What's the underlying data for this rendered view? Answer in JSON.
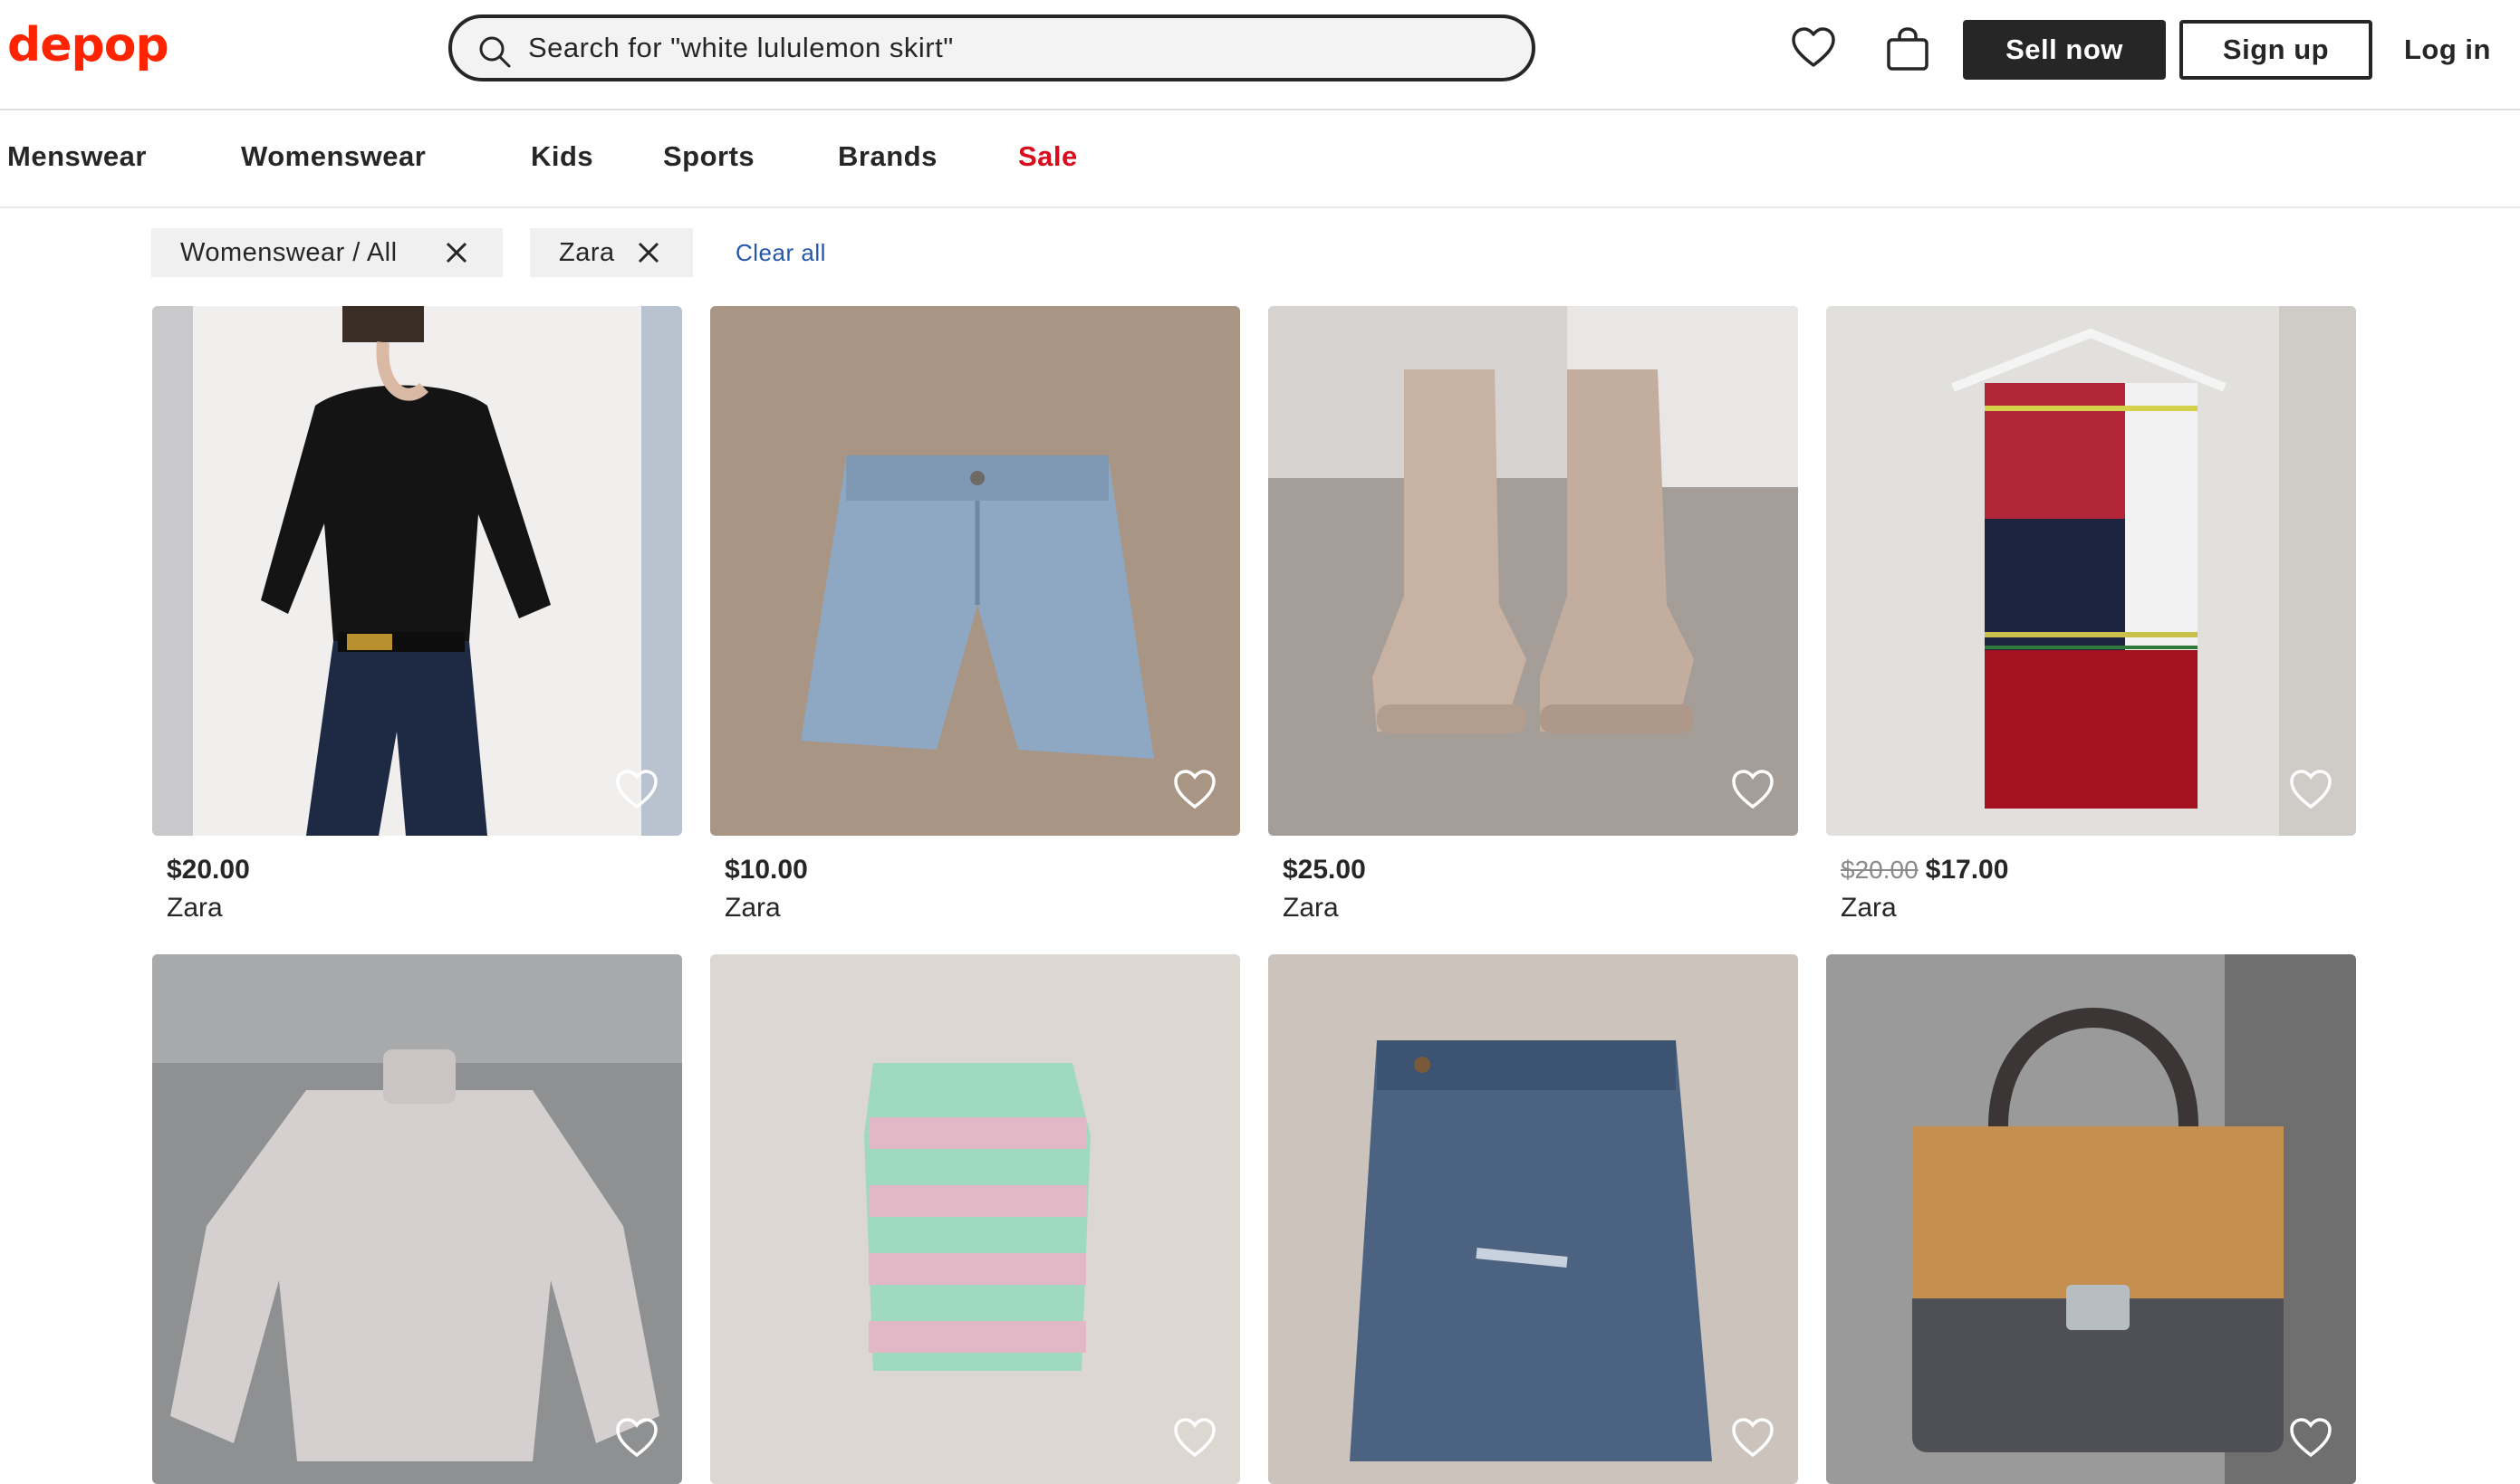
{
  "header": {
    "logo": "depop",
    "search_value": "Search for \"white lululemon skirt\"",
    "sell_label": "Sell now",
    "signup_label": "Sign up",
    "login_label": "Log in"
  },
  "categories": [
    "Menswear",
    "Womenswear",
    "Kids",
    "Sports",
    "Brands",
    "Sale"
  ],
  "filters": {
    "chips": [
      "Womenswear / All",
      "Zara"
    ],
    "clear_label": "Clear all"
  },
  "products": [
    {
      "price": "$20.00",
      "brand": "Zara",
      "item": "black halter top"
    },
    {
      "price": "$10.00",
      "brand": "Zara",
      "item": "denim shorts"
    },
    {
      "price": "$25.00",
      "brand": "Zara",
      "item": "beige boots"
    },
    {
      "price": "$17.00",
      "original_price": "$20.00",
      "brand": "Zara",
      "item": "plaid scarf"
    },
    {
      "price": "",
      "brand": "",
      "item": "cable knit sweater"
    },
    {
      "price": "",
      "brand": "",
      "item": "striped knit vest"
    },
    {
      "price": "",
      "brand": "",
      "item": "denim skirt"
    },
    {
      "price": "",
      "brand": "",
      "item": "suede handbag"
    }
  ],
  "colors": {
    "brand": "#ff2300",
    "sale": "#d90b1c",
    "link": "#2558a8",
    "dark": "#262626"
  },
  "icons": [
    "search-icon",
    "heart-icon",
    "bag-icon",
    "close-icon"
  ]
}
